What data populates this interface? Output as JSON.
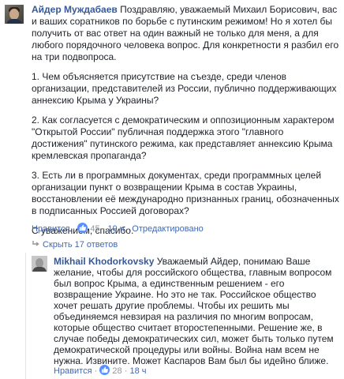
{
  "comment1": {
    "author": "Айдер Муждабаев",
    "paragraphs": [
      "Поздравляю, уважаемый Михаил Борисович, вас и ваших соратников по борьбе с путинским режимом! Но я хотел бы получить от вас ответ на один важный не только для меня, а для любого порядочного человека вопрос. Для конкретности я разбил его на три подвопроса.",
      "1. Чем объясняется присутствие на съезде, среди членов организации, представителей из России, публично поддерживающих аннексию Крыма у Украины?",
      "2. Как согласуется с демократическим и оппозиционным характером \"Открытой России\" публичная поддержка этого \"главного достижения\" путинского режима, как представляет аннексию Крыма кремлевская пропаганда?",
      "3. Есть ли в программных документах, среди программных целей организации пункт о возвращении Крыма в состав Украины, восстановлении её международно признанных границ, обозначенных в подписанных Россией договорах?",
      "С уважением, спасибо."
    ],
    "like_label": "Нравится",
    "sep": "·",
    "like_count": "45",
    "time": "19 ч",
    "edited": "Отредактировано"
  },
  "toggle": {
    "label": "Скрыть 17 ответов"
  },
  "reply": {
    "author": "Mikhail Khodorkovsky",
    "text": "Уважаемый Айдер, понимаю Ваше желание, чтобы для российского общества, главным вопросом был вопрос Крыма, а единственным решением - его возвращение Украине. Но это не так. Российское общество хочет решать другие проблемы. Чтобы их решить мы объединяемся невзирая на различия по многим вопросам, которые общество считает второстепенными. Решение же, в случае победы демократических сил, может быть только путем демократической процедуры или войны. Война нам всем не нужна. Извините. Может Каспаров Вам был бы идейно ближе.",
    "like_label": "Нравится",
    "sep": "·",
    "like_count": "28",
    "time": "18 ч"
  },
  "colors": {
    "link": "#4267b2",
    "author": "#365899",
    "meta": "#90949c",
    "like_badge": "#5890ff"
  },
  "icons": [
    "thumbs-up-icon",
    "arrow-return-icon"
  ]
}
